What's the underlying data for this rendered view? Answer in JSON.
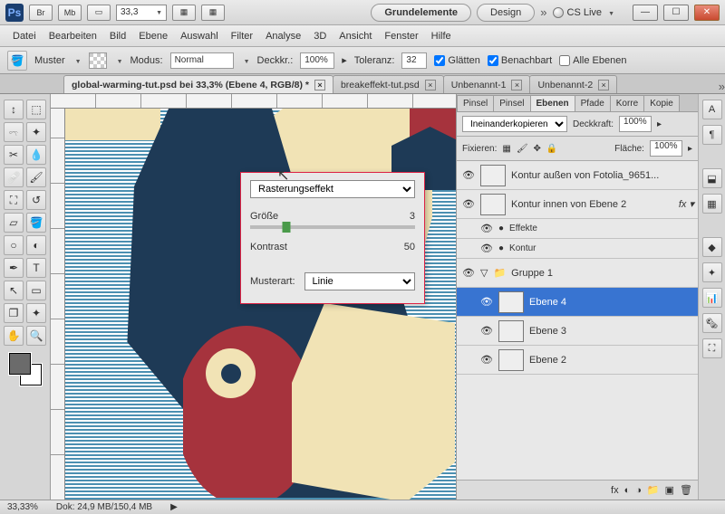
{
  "titlebar": {
    "zoom": "33,3",
    "layouts": [
      "Grundelemente",
      "Design"
    ],
    "cslive": "CS Live"
  },
  "menu": [
    "Datei",
    "Bearbeiten",
    "Bild",
    "Ebene",
    "Auswahl",
    "Filter",
    "Analyse",
    "3D",
    "Ansicht",
    "Fenster",
    "Hilfe"
  ],
  "options": {
    "muster_label": "Muster",
    "modus_label": "Modus:",
    "modus_value": "Normal",
    "deckkraft_label": "Deckkr.:",
    "deckkraft_value": "100%",
    "toleranz_label": "Toleranz:",
    "toleranz_value": "32",
    "glatten": "Glätten",
    "benachbart": "Benachbart",
    "alle_ebenen": "Alle Ebenen"
  },
  "tabs": [
    {
      "label": "global-warming-tut.psd bei 33,3% (Ebene 4, RGB/8) *",
      "active": true
    },
    {
      "label": "breakeffekt-tut.psd",
      "active": false
    },
    {
      "label": "Unbenannt-1",
      "active": false
    },
    {
      "label": "Unbenannt-2",
      "active": false
    }
  ],
  "dialog": {
    "method": "Rasterungseffekt",
    "size_label": "Größe",
    "size_value": "3",
    "contrast_label": "Kontrast",
    "contrast_value": "50",
    "musterart_label": "Musterart:",
    "musterart_value": "Linie"
  },
  "panels": {
    "tabs": [
      "Pinsel",
      "Pinsel",
      "Ebenen",
      "Pfade",
      "Korre",
      "Kopie"
    ],
    "blend_mode": "Ineinanderkopieren",
    "deckkraft_label": "Deckkraft:",
    "deckkraft_value": "100%",
    "fixieren_label": "Fixieren:",
    "flache_label": "Fläche:",
    "flache_value": "100%",
    "layers": [
      {
        "name": "Kontur außen von Fotolia_9651...",
        "sel": false,
        "indent": 0
      },
      {
        "name": "Kontur innen von Ebene 2",
        "sel": false,
        "indent": 0,
        "fx": true
      },
      {
        "name": "Effekte",
        "sel": false,
        "indent": 1,
        "small": true
      },
      {
        "name": "Kontur",
        "sel": false,
        "indent": 1,
        "small": true
      },
      {
        "name": "Gruppe 1",
        "sel": false,
        "indent": 0,
        "group": true
      },
      {
        "name": "Ebene 4",
        "sel": true,
        "indent": 1
      },
      {
        "name": "Ebene 3",
        "sel": false,
        "indent": 1
      },
      {
        "name": "Ebene 2",
        "sel": false,
        "indent": 1
      }
    ]
  },
  "status": {
    "zoom": "33,33%",
    "doc": "Dok: 24,9 MB/150,4 MB"
  }
}
